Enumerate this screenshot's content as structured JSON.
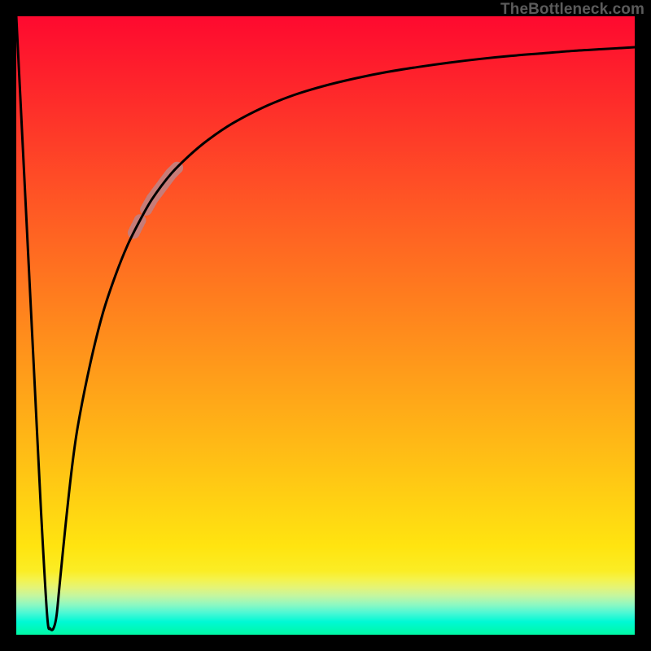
{
  "watermark": "TheBottleneck.com",
  "frame": {
    "thickness_px": 20,
    "color": "#000000"
  },
  "highlight": {
    "color": "#c77c78",
    "segments_x_range": [
      0.19,
      0.26
    ]
  },
  "chart_data": {
    "type": "line",
    "title": "",
    "xlabel": "",
    "ylabel": "",
    "xlim": [
      0,
      1
    ],
    "ylim": [
      0,
      100
    ],
    "grid": false,
    "legend": false,
    "background_gradient_stops": [
      {
        "y_frac": 0.00303,
        "color": "#fe0a2f"
      },
      {
        "y_frac": 0.14545,
        "color": "#fe2e2a"
      },
      {
        "y_frac": 0.28788,
        "color": "#ff5325"
      },
      {
        "y_frac": 0.4303,
        "color": "#ff771f"
      },
      {
        "y_frac": 0.57273,
        "color": "#ff9b1a"
      },
      {
        "y_frac": 0.71515,
        "color": "#ffbf15"
      },
      {
        "y_frac": 0.85758,
        "color": "#ffe410"
      },
      {
        "y_frac": 0.89697,
        "color": "#fbed25"
      },
      {
        "y_frac": 0.91061,
        "color": "#f4f34d"
      },
      {
        "y_frac": 0.92424,
        "color": "#e3f479"
      },
      {
        "y_frac": 0.93788,
        "color": "#c2f6a2"
      },
      {
        "y_frac": 0.95152,
        "color": "#8df8c2"
      },
      {
        "y_frac": 0.96515,
        "color": "#49f8d5"
      },
      {
        "y_frac": 0.97879,
        "color": "#00f9d5"
      },
      {
        "y_frac": 0.99242,
        "color": "#00f9b5"
      },
      {
        "y_frac": 1.0,
        "color": "#00f9a5"
      }
    ],
    "series": [
      {
        "name": "curve",
        "color": "#000000",
        "stroke_width_px": 3,
        "x": [
          0.0,
          0.01,
          0.02,
          0.03,
          0.04,
          0.05,
          0.055,
          0.06,
          0.065,
          0.07,
          0.08,
          0.09,
          0.1,
          0.12,
          0.14,
          0.16,
          0.18,
          0.2,
          0.22,
          0.25,
          0.28,
          0.31,
          0.35,
          0.4,
          0.45,
          0.5,
          0.55,
          0.6,
          0.65,
          0.7,
          0.75,
          0.8,
          0.85,
          0.9,
          0.95,
          1.0
        ],
        "y": [
          100.0,
          80.0,
          60.0,
          40.0,
          20.0,
          3.0,
          1.0,
          1.0,
          3.0,
          8.0,
          18.0,
          27.0,
          34.0,
          44.0,
          52.0,
          58.0,
          63.0,
          67.0,
          70.5,
          74.5,
          77.5,
          80.0,
          82.7,
          85.3,
          87.3,
          88.8,
          90.0,
          91.0,
          91.8,
          92.5,
          93.1,
          93.6,
          94.0,
          94.4,
          94.7,
          95.0
        ]
      }
    ],
    "highlight_marker": {
      "color": "#c77c78",
      "radius_px": 7.5,
      "x_range": [
        0.19,
        0.26
      ],
      "segment_gap_x": 0.205
    }
  }
}
